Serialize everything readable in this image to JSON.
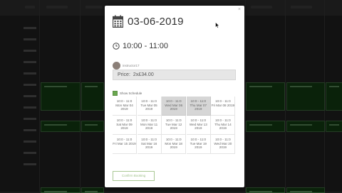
{
  "modal": {
    "date": "03-06-2019",
    "time": "10:00 - 11:00",
    "username": "instructor17",
    "price_label": "Price:",
    "price_value": "2x£34.00",
    "show_schedule_label": "Show Schedule",
    "confirm_label": "Confirm Booking",
    "close_label": "×"
  },
  "schedule": [
    {
      "time": "10:0 - 11:0",
      "date": "Mon Mar 04 2019",
      "selected": false
    },
    {
      "time": "10:0 - 11:0",
      "date": "Tue Mar 05 2019",
      "selected": false
    },
    {
      "time": "10:0 - 11:0",
      "date": "Wed Mar 06 2019",
      "selected": true
    },
    {
      "time": "10:0 - 11:0",
      "date": "Thu Mar 07 2019",
      "selected": true
    },
    {
      "time": "10:0 - 11:0",
      "date": "Fri Mar 08 2019",
      "selected": false
    },
    {
      "time": "10:0 - 11:0",
      "date": "Sat Mar 09 2019",
      "selected": false
    },
    {
      "time": "10:0 - 11:0",
      "date": "Mon Mar 11 2019",
      "selected": false
    },
    {
      "time": "10:0 - 11:0",
      "date": "Tue Mar 12 2019",
      "selected": false
    },
    {
      "time": "10:0 - 11:0",
      "date": "Wed Mar 13 2019",
      "selected": false
    },
    {
      "time": "10:0 - 11:0",
      "date": "Thu Mar 14 2019",
      "selected": false
    },
    {
      "time": "10:0 - 11:0",
      "date": "Fri Mar 15 2019",
      "selected": false
    },
    {
      "time": "10:0 - 11:0",
      "date": "Sat Mar 16 2019",
      "selected": false
    },
    {
      "time": "10:0 - 11:0",
      "date": "Mon Mar 18 2019",
      "selected": false
    },
    {
      "time": "10:0 - 11:0",
      "date": "Tue Mar 19 2019",
      "selected": false
    },
    {
      "time": "10:0 - 11:0",
      "date": "Wed Mar 20 2019",
      "selected": false
    }
  ],
  "colors": {
    "accent_green": "#6aa84f",
    "selected_slot": "#d6d6d6",
    "background_block": "#0d2a0d"
  },
  "icons": [
    "calendar-icon",
    "clock-icon",
    "check-icon",
    "close-icon",
    "mouse-cursor-icon"
  ]
}
